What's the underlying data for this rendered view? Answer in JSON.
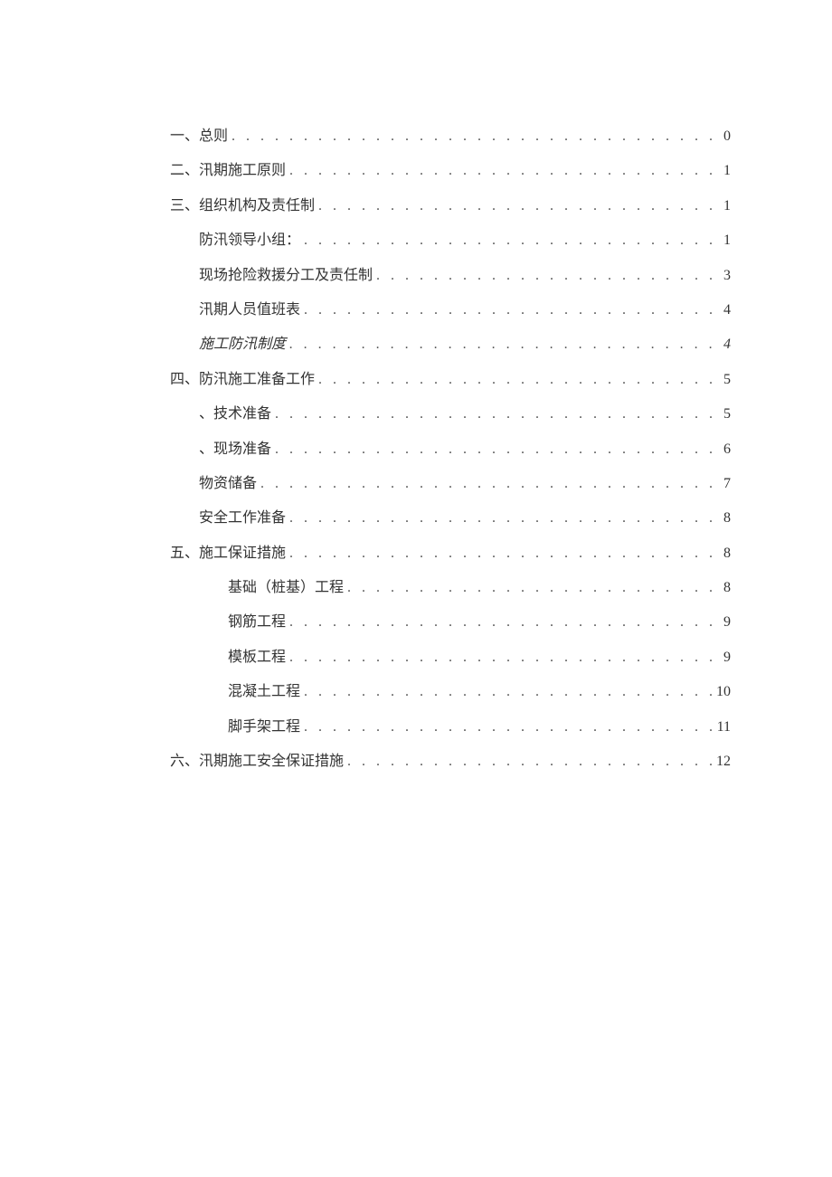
{
  "toc": [
    {
      "label": "一、总则",
      "page": "0",
      "indent": 0,
      "italic": false
    },
    {
      "label": "二、汛期施工原则",
      "page": "1",
      "indent": 0,
      "italic": false
    },
    {
      "label": "三、组织机构及责任制",
      "page": "1",
      "indent": 0,
      "italic": false
    },
    {
      "label": "防汛领导小组：",
      "page": "1",
      "indent": 1,
      "italic": false
    },
    {
      "label": "现场抢险救援分工及责任制",
      "page": "3",
      "indent": 1,
      "italic": false
    },
    {
      "label": "汛期人员值班表",
      "page": "4",
      "indent": 1,
      "italic": false
    },
    {
      "label": "施工防汛制度",
      "page": "4",
      "indent": 1,
      "italic": true
    },
    {
      "label": "四、防汛施工准备工作",
      "page": "5",
      "indent": 0,
      "italic": false
    },
    {
      "label": "、技术准备",
      "page": "5",
      "indent": 1,
      "italic": false
    },
    {
      "label": "、现场准备",
      "page": "6",
      "indent": 1,
      "italic": false
    },
    {
      "label": "物资储备",
      "page": "7",
      "indent": 1,
      "italic": false
    },
    {
      "label": "安全工作准备",
      "page": "8",
      "indent": 1,
      "italic": false
    },
    {
      "label": "五、施工保证措施",
      "page": "8",
      "indent": 0,
      "italic": false
    },
    {
      "label": "基础（桩基）工程",
      "page": "8",
      "indent": 2,
      "italic": false
    },
    {
      "label": "钢筋工程",
      "page": "9",
      "indent": 2,
      "italic": false
    },
    {
      "label": "模板工程",
      "page": "9",
      "indent": 2,
      "italic": false
    },
    {
      "label": "混凝土工程",
      "page": "10",
      "indent": 2,
      "italic": false
    },
    {
      "label": "脚手架工程",
      "page": "11",
      "indent": 2,
      "italic": false
    },
    {
      "label": "六、汛期施工安全保证措施",
      "page": "12",
      "indent": 0,
      "italic": false
    }
  ]
}
